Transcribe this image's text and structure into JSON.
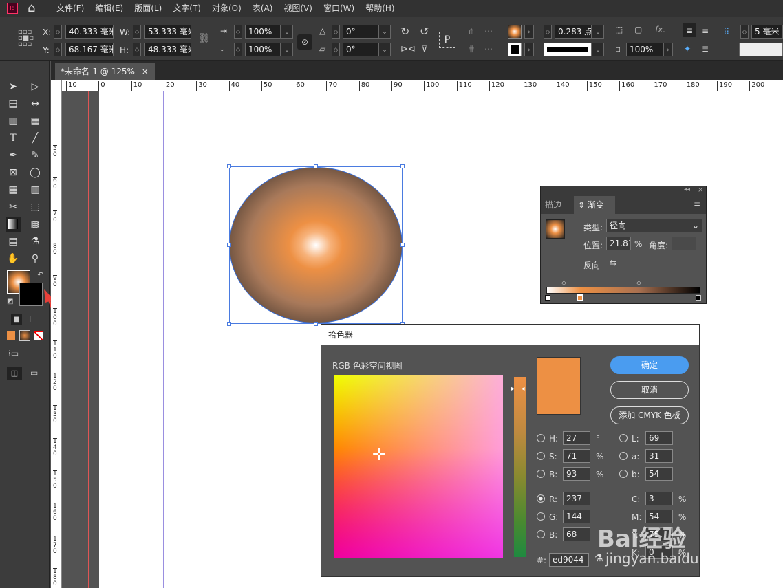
{
  "app": {
    "logo": "Id"
  },
  "menu": [
    "文件(F)",
    "编辑(E)",
    "版面(L)",
    "文字(T)",
    "对象(O)",
    "表(A)",
    "视图(V)",
    "窗口(W)",
    "帮助(H)"
  ],
  "control": {
    "x_label": "X:",
    "x_value": "40.333 毫米",
    "y_label": "Y:",
    "y_value": "68.167 毫米",
    "w_label": "W:",
    "w_value": "53.333 毫米",
    "h_label": "H:",
    "h_value": "48.333 毫米",
    "scale_x": "100%",
    "scale_y": "100%",
    "rotate": "0°",
    "shear": "0°",
    "stroke_weight": "0.283 点",
    "opacity": "100%",
    "gap": "5 毫米",
    "p_glyph": "P",
    "fx": "fx."
  },
  "doc_tab": {
    "title": "*未命名-1 @ 125%",
    "close": "×"
  },
  "ruler_h": [
    "10",
    "0",
    "10",
    "20",
    "30",
    "40",
    "50",
    "60",
    "70",
    "80",
    "90",
    "100",
    "110",
    "120",
    "130",
    "140",
    "150",
    "160",
    "170",
    "180",
    "190",
    "200"
  ],
  "ruler_v": [
    "5\n0",
    "6\n0",
    "7\n0",
    "8\n0",
    "9\n0",
    "1\n0\n0",
    "1\n1\n0",
    "1\n2\n0",
    "1\n3\n0",
    "1\n4\n0",
    "1\n5\n0",
    "1\n6\n0",
    "1\n7\n0",
    "1\n8\n0"
  ],
  "gradient_panel": {
    "tab_stroke": "描边",
    "tab_gradient": "渐变",
    "type_label": "类型:",
    "type_value": "径向",
    "location_label": "位置:",
    "location_value": "21.81",
    "location_unit": "%",
    "angle_label": "角度:",
    "angle_value": "",
    "reverse_label": "反向"
  },
  "color_picker": {
    "title": "拾色器",
    "space_label": "RGB 色彩空间视图",
    "ok": "确定",
    "cancel": "取消",
    "add_swatch": "添加 CMYK 色板",
    "H_label": "H:",
    "H": "27",
    "H_unit": "°",
    "S_label": "S:",
    "S": "71",
    "S_unit": "%",
    "Bv_label": "B:",
    "Bv": "93",
    "Bv_unit": "%",
    "L_label": "L:",
    "L": "69",
    "a_label": "a:",
    "a": "31",
    "bb_label": "b:",
    "bb": "54",
    "R_label": "R:",
    "R": "237",
    "G_label": "G:",
    "G": "144",
    "Bc_label": "B:",
    "Bc": "68",
    "C_label": "C:",
    "C": "3",
    "C_unit": "%",
    "M_label": "M:",
    "M": "54",
    "M_unit": "%",
    "Y_label": "Y:",
    "Y": "75",
    "Y_unit": "%",
    "K_label": "K:",
    "K": "0",
    "K_unit": "%",
    "hex_label": "#:",
    "hex": "ed9044"
  },
  "watermark": {
    "text": "Bai经验",
    "url": "jingyan.baidu.com"
  },
  "colors": {
    "picked": "#ed9044",
    "accent": "#4a9cf0"
  }
}
